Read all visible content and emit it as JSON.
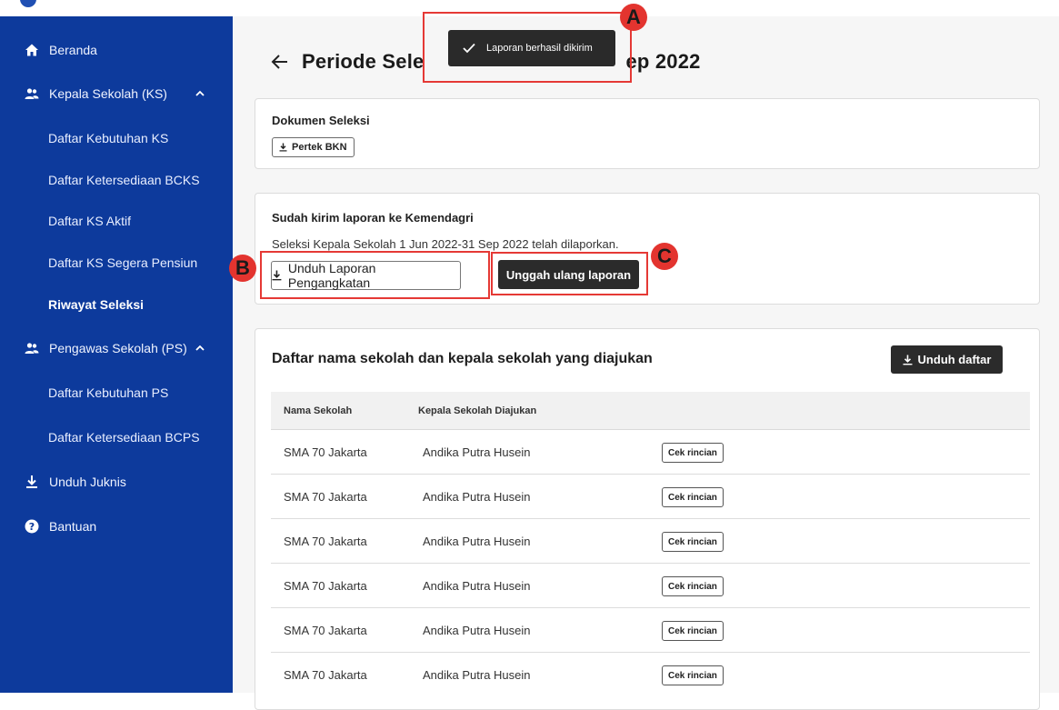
{
  "sidebar": {
    "items": [
      {
        "label": "Beranda",
        "icon": "home-icon"
      },
      {
        "label": "Kepala Sekolah (KS)",
        "icon": "people-icon",
        "expanded": true
      },
      {
        "label": "Pengawas Sekolah (PS)",
        "icon": "people-icon",
        "expanded": true
      },
      {
        "label": "Unduh Juknis",
        "icon": "download-icon"
      },
      {
        "label": "Bantuan",
        "icon": "help-icon"
      }
    ],
    "ks_sub": [
      "Daftar Kebutuhan KS",
      "Daftar Ketersediaan BCKS",
      "Daftar KS Aktif",
      "Daftar KS Segera Pensiun",
      "Riwayat Seleksi"
    ],
    "ps_sub": [
      "Daftar Kebutuhan PS",
      "Daftar Ketersediaan BCPS"
    ],
    "active_sub": "Riwayat Seleksi"
  },
  "page": {
    "title_left": "Periode Sele",
    "title_right": "ep 2022"
  },
  "toast": {
    "message": "Laporan berhasil dikirim",
    "icon": "check-icon"
  },
  "card_dokumen": {
    "title": "Dokumen Seleksi",
    "button": "Pertek BKN"
  },
  "card_laporan": {
    "title": "Sudah kirim laporan ke Kemendagri",
    "description": "Seleksi Kepala Sekolah 1 Jun 2022-31 Sep 2022 telah dilaporkan.",
    "download_button": "Unduh Laporan Pengangkatan",
    "reupload_button": "Unggah ulang laporan"
  },
  "list": {
    "title": "Daftar nama sekolah dan kepala sekolah yang diajukan",
    "download_button": "Unduh daftar",
    "columns": [
      "Nama Sekolah",
      "Kepala Sekolah Diajukan"
    ],
    "rows": [
      {
        "school": "SMA 70 Jakarta",
        "head": "Andika Putra Husein",
        "action": "Cek rincian"
      },
      {
        "school": "SMA 70 Jakarta",
        "head": "Andika Putra Husein",
        "action": "Cek rincian"
      },
      {
        "school": "SMA 70 Jakarta",
        "head": "Andika Putra Husein",
        "action": "Cek rincian"
      },
      {
        "school": "SMA 70 Jakarta",
        "head": "Andika Putra Husein",
        "action": "Cek rincian"
      },
      {
        "school": "SMA 70 Jakarta",
        "head": "Andika Putra Husein",
        "action": "Cek rincian"
      },
      {
        "school": "SMA 70 Jakarta",
        "head": "Andika Putra Husein",
        "action": "Cek rincian"
      }
    ]
  },
  "annotations": {
    "a": "A",
    "b": "B",
    "c": "C",
    "color": "#e53935"
  },
  "colors": {
    "sidebar": "#0d3a9c",
    "dark_button": "#2b2b2b",
    "toast": "#2a2a2a"
  }
}
